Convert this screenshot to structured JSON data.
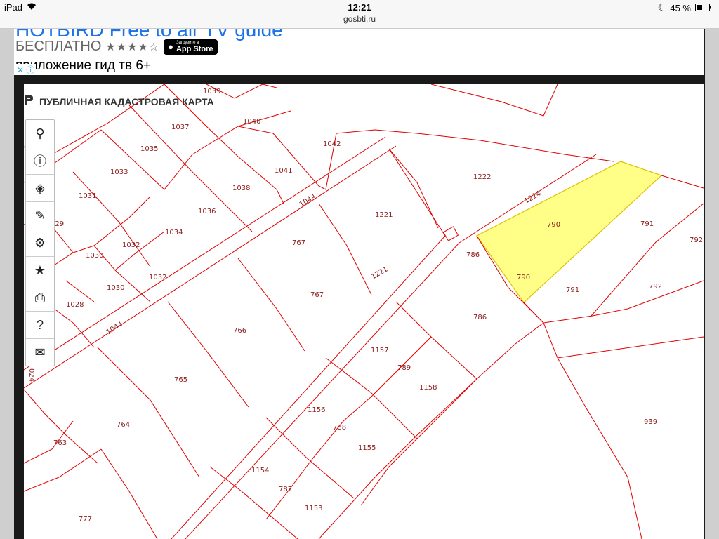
{
  "status": {
    "device": "iPad",
    "time": "12:21",
    "battery": "45 %"
  },
  "url": "gosbti.ru",
  "ad": {
    "title": "HOTBIRD Free to air TV guide",
    "price": "БЕСПЛАТНО",
    "stars": "★★★★☆",
    "appstore_small": "Загрузите в",
    "appstore_big": "App Store",
    "desc": "приложение гид тв 6+",
    "close": "✕ ⓘ"
  },
  "map": {
    "header": "ПУБЛИЧНАЯ КАДАСТРОВАЯ КАРТА",
    "tools": [
      "search-icon",
      "info-icon",
      "layers-icon",
      "pencil-icon",
      "ruler-icon",
      "star-icon",
      "print-icon",
      "help-icon",
      "mail-icon"
    ],
    "highlight_color": "#ffff88",
    "line_color": "#e00000",
    "parcel_labels": [
      "1039",
      "1037",
      "1040",
      "1042",
      "1035",
      "1041",
      "1033",
      "1038",
      "1031",
      "1044",
      "1036",
      "1034",
      "029",
      "1032",
      "1030",
      "1032",
      "1030",
      "1028",
      "1044",
      "1222",
      "1224",
      "790",
      "791",
      "792",
      "1221",
      "767",
      "786",
      "790",
      "791",
      "792",
      "1221",
      "767",
      "786",
      "766",
      "1157",
      "789",
      "1158",
      "765",
      "1156",
      "788",
      "764",
      "763",
      "1155",
      "939",
      "1154",
      "787",
      "1153",
      "777",
      "024"
    ]
  }
}
